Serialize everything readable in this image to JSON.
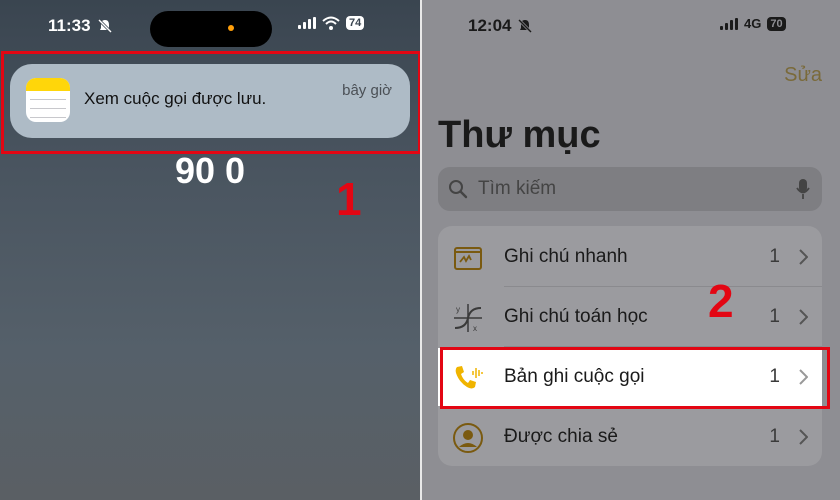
{
  "left_screen": {
    "time": "11:33",
    "battery": "74",
    "lock_time_partial": "",
    "lock_date": "90 0",
    "notification": {
      "message": "Xem cuộc gọi được lưu.",
      "time": "bây giờ"
    },
    "step_number": "1"
  },
  "right_screen": {
    "time": "12:04",
    "network": "4G",
    "battery": "70",
    "edit_label": "Sửa",
    "title": "Thư mục",
    "search_placeholder": "Tìm kiếm",
    "folders": [
      {
        "label": "Ghi chú nhanh",
        "count": "1",
        "icon": "quick-note-icon"
      },
      {
        "label": "Ghi chú toán học",
        "count": "1",
        "icon": "math-note-icon"
      },
      {
        "label": "Bản ghi cuộc gọi",
        "count": "1",
        "icon": "call-recording-icon"
      },
      {
        "label": "Được chia sẻ",
        "count": "1",
        "icon": "shared-person-icon"
      }
    ],
    "step_number": "2"
  },
  "colors": {
    "highlight": "#e30613",
    "accent_yellow": "#ffd60a",
    "call_icon": "#f0b400"
  }
}
